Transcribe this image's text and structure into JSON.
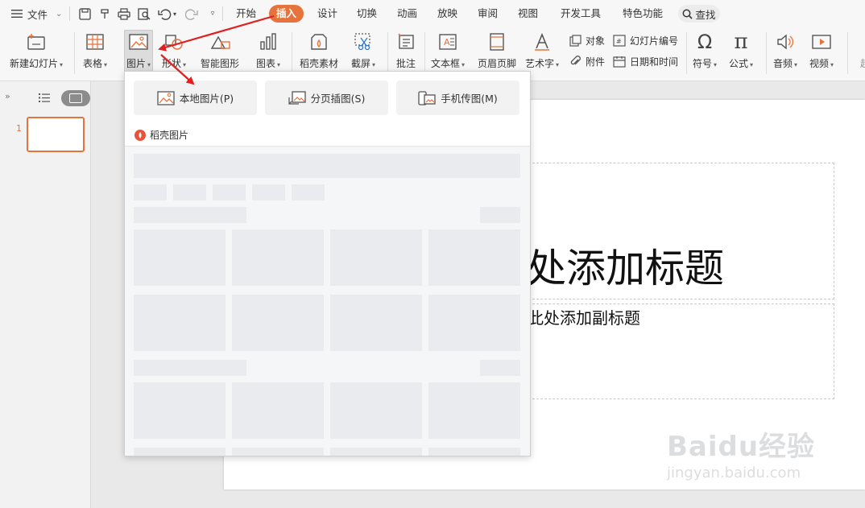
{
  "menubar": {
    "file_label": "文件",
    "tabs": [
      {
        "label": "开始"
      },
      {
        "label": "插入"
      },
      {
        "label": "设计"
      },
      {
        "label": "切换"
      },
      {
        "label": "动画"
      },
      {
        "label": "放映"
      },
      {
        "label": "审阅"
      },
      {
        "label": "视图"
      },
      {
        "label": "开发工具"
      },
      {
        "label": "特色功能"
      }
    ],
    "active_tab": "插入",
    "search_label": "查找"
  },
  "ribbon": {
    "new_slide": "新建幻灯片",
    "table": "表格",
    "picture": "图片",
    "shape": "形状",
    "smartart": "智能图形",
    "chart": "图表",
    "docer_material": "稻壳素材",
    "screenshot": "截屏",
    "comment": "批注",
    "textbox": "文本框",
    "header_footer": "页眉页脚",
    "wordart": "艺术字",
    "object": "对象",
    "attachment": "附件",
    "slide_number": "幻灯片编号",
    "date_time": "日期和时间",
    "symbol": "符号",
    "formula": "公式",
    "audio": "音频",
    "video": "视频",
    "more": "超"
  },
  "left_panel": {
    "slide_number": "1"
  },
  "slide": {
    "title_placeholder": "处添加标题",
    "subtitle_placeholder": "此处添加副标题"
  },
  "picture_dropdown": {
    "local_picture": "本地图片(P)",
    "paged_insert": "分页插图(S)",
    "phone_transfer": "手机传图(M)",
    "docer_pictures": "稻壳图片"
  },
  "watermark": {
    "brand": "Baidu经验",
    "url": "jingyan.baidu.com"
  },
  "colors": {
    "accent": "#e6733b",
    "arrow": "#e02020"
  }
}
